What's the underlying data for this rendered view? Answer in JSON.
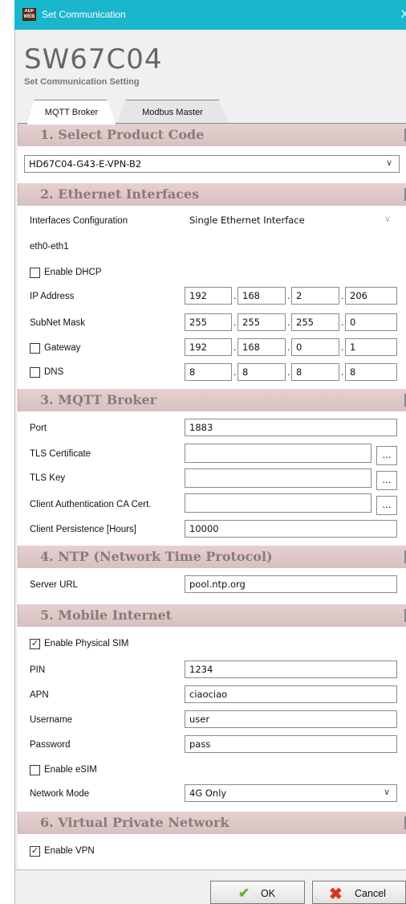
{
  "window": {
    "title": "Set Communication",
    "close": "X",
    "icon_text": "ADF WEB"
  },
  "brand": {
    "name": "SW67C04",
    "subtitle": "Set Communication Setting"
  },
  "tabs": [
    {
      "label": "MQTT Broker",
      "active": true
    },
    {
      "label": "Modbus Master",
      "active": false
    }
  ],
  "sections": {
    "s1": "1. Select Product Code",
    "s2": "2. Ethernet Interfaces",
    "s3": "3. MQTT Broker",
    "s4": "4. NTP (Network Time Protocol)",
    "s5": "5. Mobile Internet",
    "s6": "6. Virtual Private Network"
  },
  "product_code": "HD67C04-G43-E-VPN-B2",
  "ethernet": {
    "interfaces_label": "Interfaces Configuration",
    "interfaces_value": "Single Ethernet Interface",
    "eth_label": "eth0-eth1",
    "dhcp_label": "Enable DHCP",
    "dhcp_checked": false,
    "ip_label": "IP Address",
    "ip": [
      "192",
      "168",
      "2",
      "206"
    ],
    "mask_label": "SubNet Mask",
    "mask": [
      "255",
      "255",
      "255",
      "0"
    ],
    "gw_label": "Gateway",
    "gw_checked": false,
    "gw": [
      "192",
      "168",
      "0",
      "1"
    ],
    "dns_label": "DNS",
    "dns_checked": false,
    "dns": [
      "8",
      "8",
      "8",
      "8"
    ]
  },
  "mqtt": {
    "port_label": "Port",
    "port": "1883",
    "tls_cert_label": "TLS Certificate",
    "tls_cert": "",
    "tls_key_label": "TLS Key",
    "tls_key": "",
    "ca_label": "Client Authentication CA Cert.",
    "ca": "",
    "browse": "...",
    "persist_label": "Client Persistence [Hours]",
    "persist": "10000"
  },
  "ntp": {
    "server_label": "Server URL",
    "server": "pool.ntp.org"
  },
  "mobile": {
    "sim_label": "Enable Physical SIM",
    "sim_checked": true,
    "pin_label": "PIN",
    "pin": "1234",
    "apn_label": "APN",
    "apn": "ciaociao",
    "user_label": "Username",
    "user": "user",
    "pass_label": "Password",
    "pass": "pass",
    "esim_label": "Enable eSIM",
    "esim_checked": false,
    "mode_label": "Network Mode",
    "mode": "4G Only"
  },
  "vpn": {
    "label": "Enable VPN",
    "checked": true
  },
  "buttons": {
    "ok": "OK",
    "cancel": "Cancel"
  },
  "colors": {
    "titlebar": "#19b6cc",
    "section": "#dcc6c6",
    "ok_icon": "#5cb82e",
    "cancel_icon": "#e03020"
  }
}
